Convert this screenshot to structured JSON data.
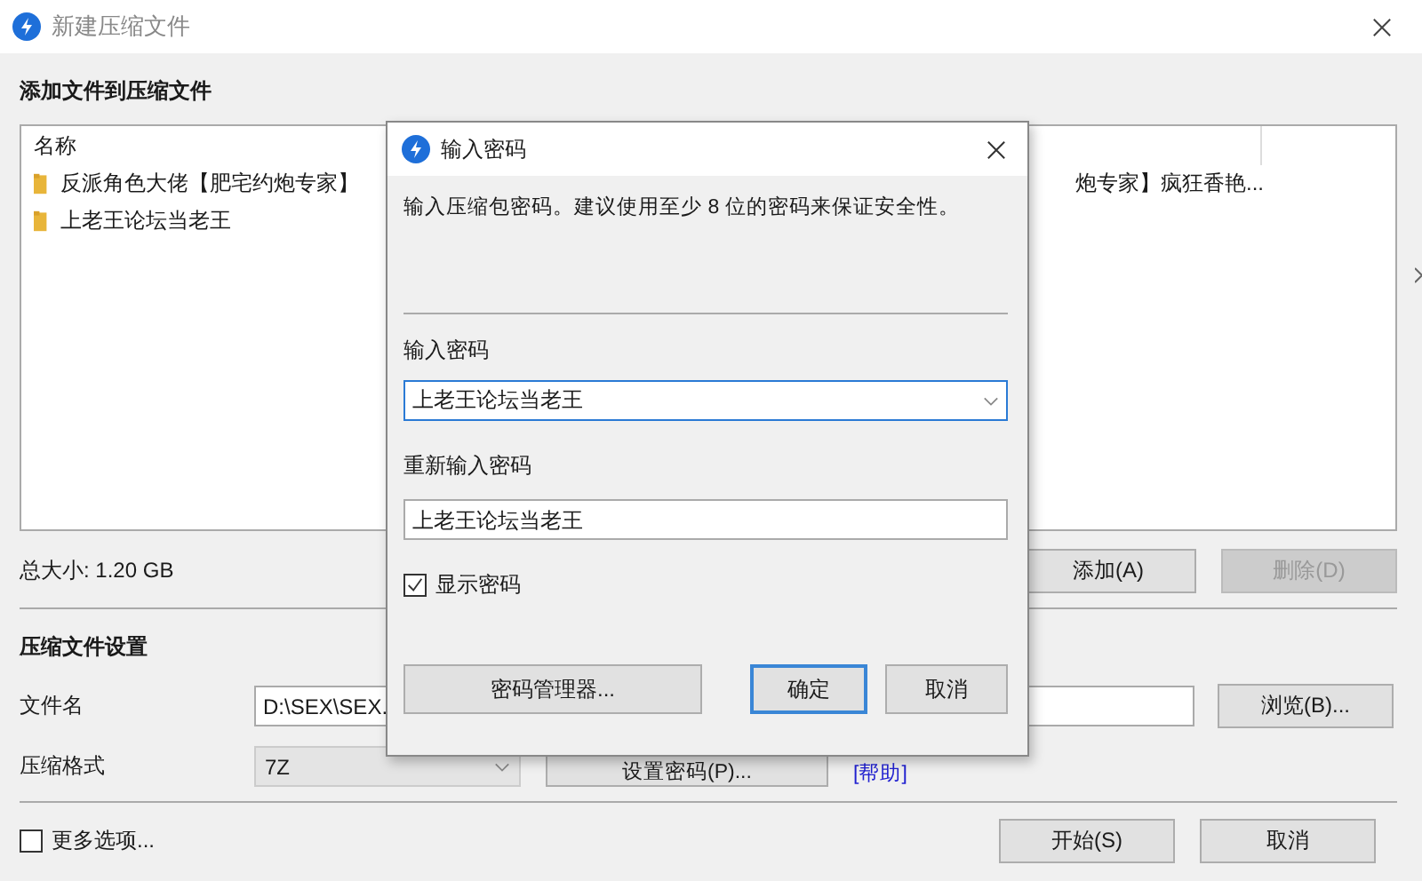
{
  "window": {
    "title": "新建压缩文件"
  },
  "add_section": {
    "heading": "添加文件到压缩文件",
    "columns": [
      "名称"
    ],
    "rows": [
      {
        "name_left": "反派角色大佬【肥宅约炮专家】",
        "name_right": "炮专家】疯狂香艳..."
      },
      {
        "name_left": "上老王论坛当老王"
      }
    ],
    "total_size": "总大小: 1.20 GB",
    "buttons": [
      {
        "label": "添加(A)",
        "disabled": false
      },
      {
        "label": "删除(D)",
        "disabled": true
      }
    ]
  },
  "settings": {
    "heading": "压缩文件设置",
    "filename_label": "文件名",
    "filename_value": "D:\\SEX\\SEX.",
    "browse_button": "浏览(B)...",
    "format_label": "压缩格式",
    "format_value": "7Z",
    "set_password_button": "设置密码(P)...",
    "help_link": "[帮助]"
  },
  "more_options": {
    "label": "更多选项...",
    "checked": false
  },
  "footer_buttons": [
    "开始(S)",
    "取消"
  ],
  "dialog": {
    "title": "输入密码",
    "description": "输入压缩包密码。建议使用至少 8 位的密码来保证安全性。",
    "password_label": "输入密码",
    "password_value": "上老王论坛当老王",
    "repeat_label": "重新输入密码",
    "repeat_value": "上老王论坛当老王",
    "show_password": {
      "label": "显示密码",
      "checked": true
    },
    "manager_button": "密码管理器...",
    "ok_button": "确定",
    "cancel_button": "取消"
  }
}
